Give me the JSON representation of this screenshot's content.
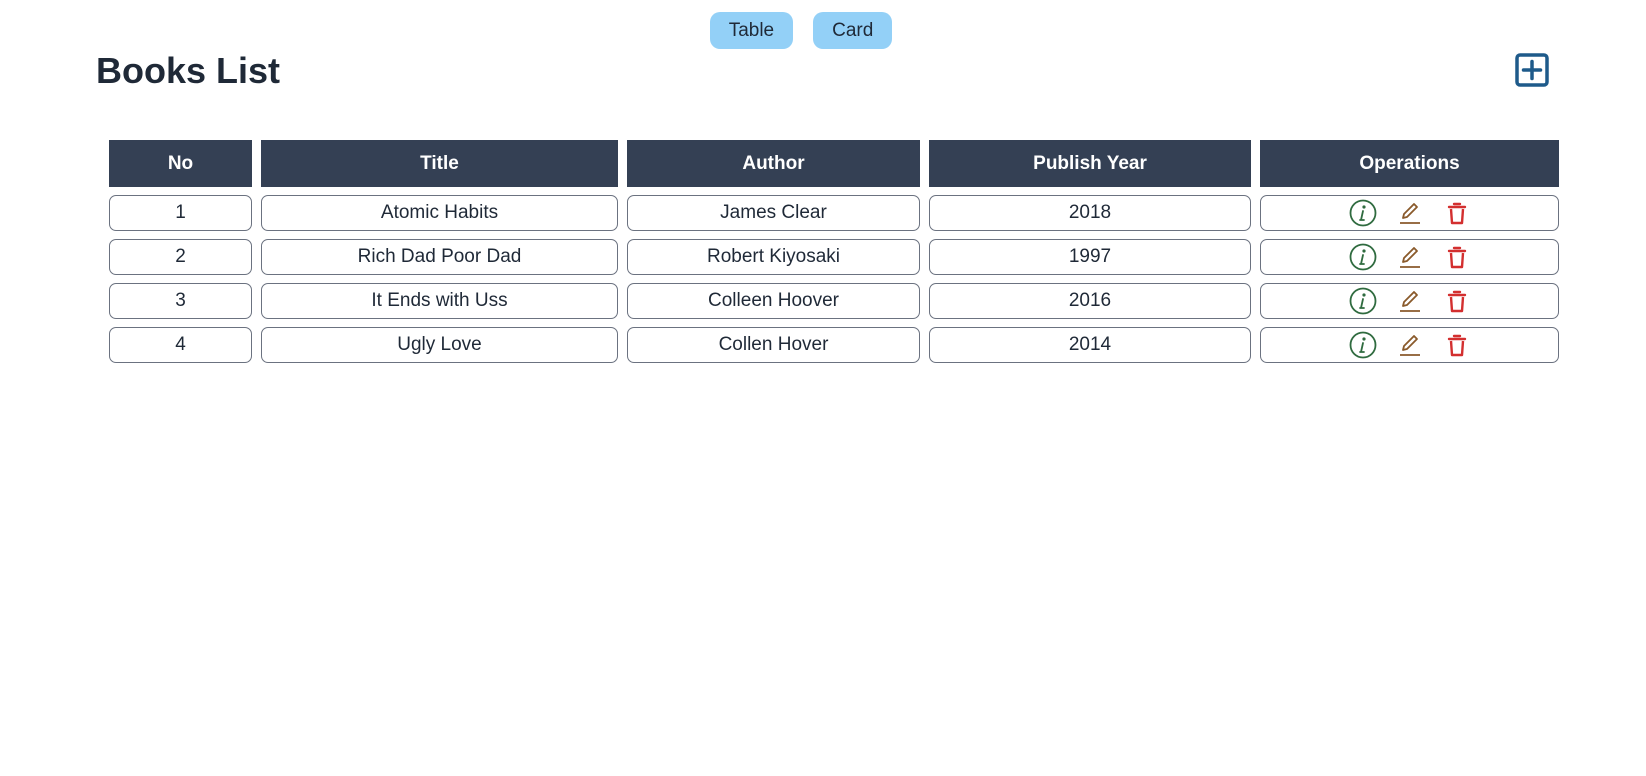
{
  "view_toggle": {
    "table_label": "Table",
    "card_label": "Card"
  },
  "page": {
    "title": "Books List",
    "add_icon": "plus-square-icon"
  },
  "table": {
    "headers": [
      "No",
      "Title",
      "Author",
      "Publish Year",
      "Operations"
    ],
    "rows": [
      {
        "no": "1",
        "title": "Atomic Habits",
        "author": "James Clear",
        "year": "2018"
      },
      {
        "no": "2",
        "title": "Rich Dad Poor Dad",
        "author": "Robert Kiyosaki",
        "year": "1997"
      },
      {
        "no": "3",
        "title": "It Ends with Uss",
        "author": "Colleen Hoover",
        "year": "2016"
      },
      {
        "no": "4",
        "title": "Ugly Love",
        "author": "Collen Hover",
        "year": "2014"
      }
    ],
    "operation_icons": [
      "info-circle-icon",
      "edit-pencil-icon",
      "delete-trash-icon"
    ]
  },
  "colors": {
    "toggle_bg": "#93d0f7",
    "header_bg": "#344054",
    "add_icon": "#1e5a8a",
    "info_icon": "#2f6b3f",
    "edit_icon": "#8a5a2b",
    "delete_icon": "#d32f2f"
  }
}
